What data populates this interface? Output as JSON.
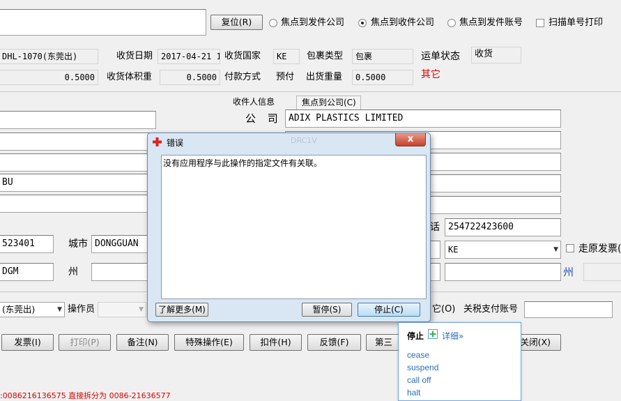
{
  "top": {
    "reset_button": "复位(R)",
    "focus_options": [
      {
        "label": "焦点到发件公司",
        "selected": false
      },
      {
        "label": "焦点到收件公司",
        "selected": true
      },
      {
        "label": "焦点到发件账号",
        "selected": false
      }
    ],
    "scan_print_label": "扫描单号打印"
  },
  "row1": {
    "origin_value": "DHL-1070(东莞出)",
    "receive_date_label": "收货日期",
    "receive_date_value": "2017-04-21 1",
    "receive_country_label": "收货国家",
    "receive_country_value": "KE",
    "package_type_label": "包裹类型",
    "package_type_value": "包裹",
    "waybill_status_label": "运单状态",
    "waybill_status_value": "收货"
  },
  "row2": {
    "weight_value": "0.5000",
    "volume_weight_label": "收货体积重",
    "volume_weight_value": "0.5000",
    "payment_label": "付款方式",
    "payment_value": "预付",
    "outgoing_weight_label": "出货重量",
    "outgoing_weight_value": "0.5000",
    "other_label": "其它"
  },
  "receiver": {
    "section_title": "收件人信息",
    "focus_tab": "焦点到公司(C)",
    "company_label": "公 司",
    "company_value": "ADIX PLASTICS LIMITED",
    "phone_label": "话",
    "phone_value": "254722423600",
    "country_value": "KE",
    "walk_invoice_label": "走原发票(",
    "state_label": "州"
  },
  "sender": {
    "line4_value": "BU",
    "postcode_value": "523401",
    "city_label": "城市",
    "city_value": "DONGGUAN",
    "code_value": "DGM",
    "state_label": "州"
  },
  "bottom_row": {
    "origin_combo": "(东莞出)",
    "operator_label": "操作员",
    "other_label": "它(O)",
    "tax_account_label": "关税支付账号"
  },
  "buttons": {
    "invoice": "发票(I)",
    "print": "打印(P)",
    "remark": "备注(N)",
    "special": "特殊操作(E)",
    "hold": "扣件(H)",
    "feedback": "反馈(F)",
    "third": "第三",
    "close": "关闭(X)"
  },
  "footer": {
    "split_text": ":0086216136575 直接拆分为 0086-21636577"
  },
  "dialog": {
    "title": "错误",
    "message": "没有应用程序与此操作的指定文件有关联。",
    "learn_more": "了解更多(M)",
    "pause": "暂停(S)",
    "stop": "停止(C)",
    "close_glyph": "x",
    "hidden_text": "DRC1V"
  },
  "tooltip": {
    "title": "停止",
    "detail_link": "详细»",
    "options": [
      "cease",
      "suspend",
      "call off",
      "halt"
    ]
  },
  "colors": {
    "red_text": "#e00000",
    "blue_text": "#1f4fbf",
    "link_blue": "#2a6ebb"
  }
}
